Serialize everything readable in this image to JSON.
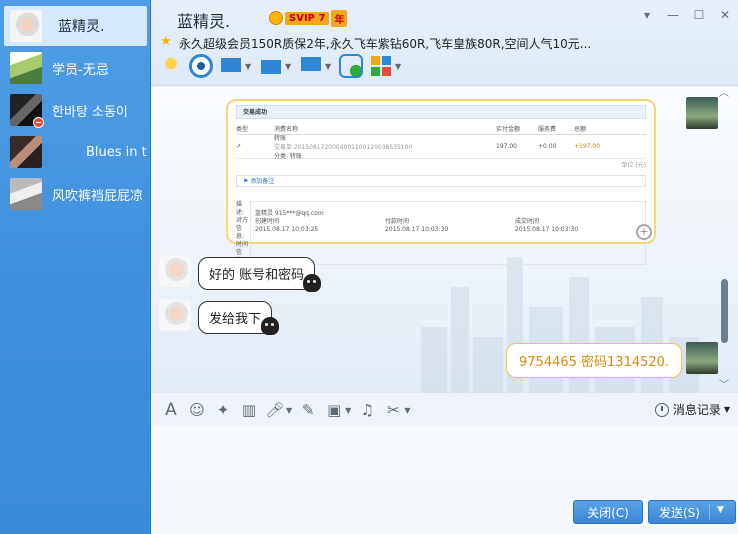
{
  "sidebar": {
    "contacts": [
      {
        "name": "蓝精灵.",
        "active": true
      },
      {
        "name": "学员-无忌",
        "active": false
      },
      {
        "name": "한바탕 소동이",
        "active": false
      },
      {
        "name": "Blues in th",
        "active": false
      },
      {
        "name": "风吹裤裆屁屁凉",
        "active": false
      }
    ]
  },
  "header": {
    "title": "蓝精灵.",
    "vip_label": "SVIP 7",
    "vip_year": "年",
    "signature": "永久超级会员150R质保2年,永久飞车紫钻60R,飞车皇族80R,空间人气10元..."
  },
  "chat": {
    "receipt": {
      "title": "交易成功",
      "headers": [
        "类型",
        "消费名称",
        "实付金额",
        "服务费",
        "总额"
      ],
      "row_name": "转账",
      "row_sub": "交易单 2015081720004001100120038535100",
      "row_sub2": "分类: 转账",
      "amount": "197.00",
      "fee": "+0.00",
      "total": "+197.00",
      "unit_note": "单位 (元)",
      "add_remark": "添加备注",
      "meta_desc_label": "描述:",
      "meta_party_label": "对方信息:",
      "meta_party_value": "蓝精灵 915***@qq.com",
      "meta_time_label": "时间信息:",
      "time_headers": [
        "创建时间",
        "付款时间",
        "成交时间"
      ],
      "times": [
        "2015.08.17 10:03:25",
        "2015.08.17 10:03:30",
        "2015.08.17 10:03:30"
      ]
    },
    "messages": [
      {
        "side": "left",
        "text": "好的 账号和密码"
      },
      {
        "side": "left",
        "text": "发给我下"
      },
      {
        "side": "right",
        "text": "9754465  密码1314520."
      }
    ]
  },
  "input_toolbar": {
    "history_label": "消息记录"
  },
  "buttons": {
    "close_label": "关闭(C)",
    "send_label": "发送(S)"
  },
  "colors": {
    "sidebar": "#3e8fdb",
    "accent": "#3a86d3",
    "vip": "#f2a71b",
    "right_bubble_border": "#f0c34a",
    "right_bubble_text": "#d68a10"
  }
}
